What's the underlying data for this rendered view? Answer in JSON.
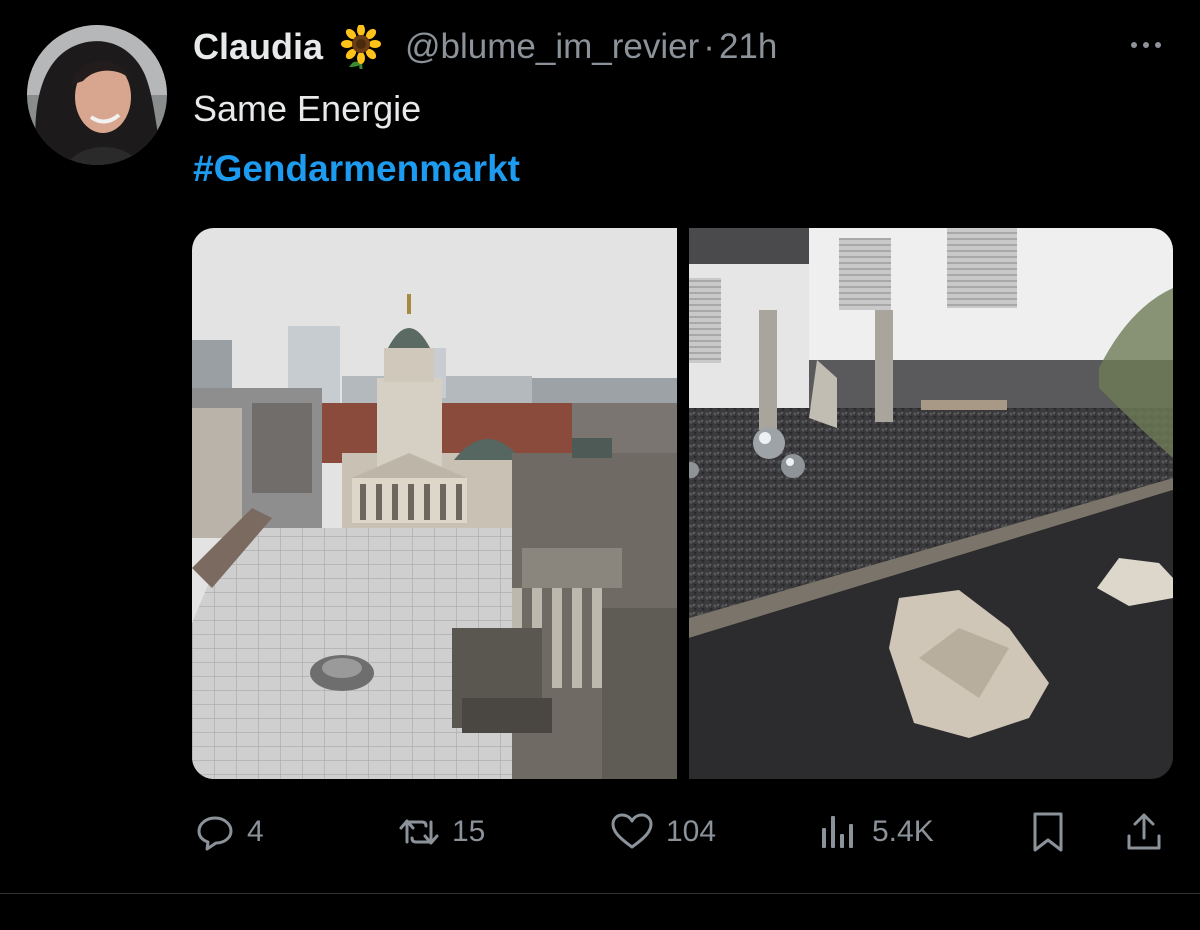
{
  "author": {
    "display_name": "Claudia",
    "emoji": "sunflower",
    "handle": "@blume_im_revier",
    "separator": "·",
    "time_ago": "21h"
  },
  "tweet": {
    "text": "Same Energie",
    "hashtag": "#Gendarmenmarkt"
  },
  "media": {
    "images": [
      {
        "description_name": "gendarmenmarkt-photo"
      },
      {
        "description_name": "gravel-garden-photo"
      }
    ]
  },
  "actions": {
    "replies": "4",
    "reposts": "15",
    "likes": "104",
    "views": "5.4K"
  },
  "colors": {
    "background": "#000000",
    "text": "#e7e9ea",
    "muted": "#8b9299",
    "accent": "#1d9bf0"
  },
  "icons": [
    "more-icon",
    "reply-icon",
    "repost-icon",
    "like-icon",
    "views-icon",
    "bookmark-icon",
    "share-icon"
  ]
}
